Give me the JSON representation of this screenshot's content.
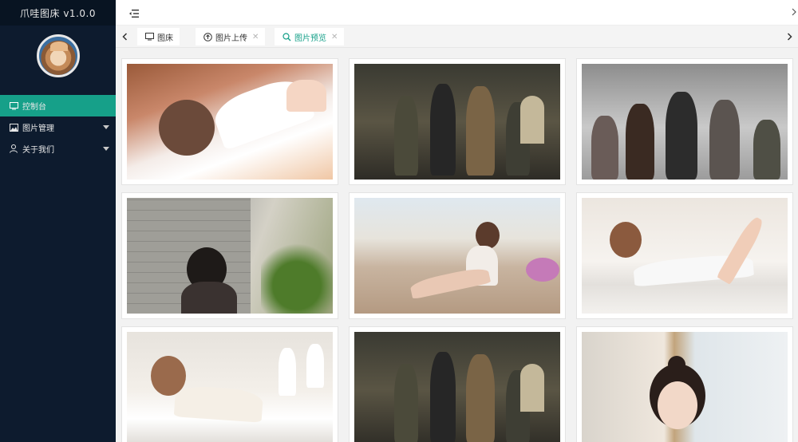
{
  "app": {
    "title": "爪哇图床 v1.0.0"
  },
  "sidebar": {
    "items": [
      {
        "label": "控制台",
        "icon": "monitor-icon",
        "active": true,
        "has_caret": false
      },
      {
        "label": "图片管理",
        "icon": "image-icon",
        "active": false,
        "has_caret": true
      },
      {
        "label": "关于我们",
        "icon": "user-icon",
        "active": false,
        "has_caret": true
      }
    ]
  },
  "tabs": [
    {
      "label": "图床",
      "icon": "monitor-icon",
      "closable": false,
      "active": false
    },
    {
      "label": "图片上传",
      "icon": "upload-icon",
      "closable": true,
      "active": false
    },
    {
      "label": "图片预览",
      "icon": "search-icon",
      "closable": true,
      "active": true
    }
  ],
  "colors": {
    "accent": "#16a089",
    "sidebar_bg": "#0d1b2e",
    "brand_bg": "#081422"
  },
  "gallery": {
    "images": [
      {
        "subject": "anime-girl-lying"
      },
      {
        "subject": "soldiers-group"
      },
      {
        "subject": "soldiers-with-guns"
      },
      {
        "subject": "girl-brick-wall"
      },
      {
        "subject": "girl-sitting-outdoor"
      },
      {
        "subject": "girl-lying-bed-white"
      },
      {
        "subject": "girl-bed-headphones"
      },
      {
        "subject": "soldiers-group-2"
      },
      {
        "subject": "girl-window-portrait"
      }
    ]
  }
}
